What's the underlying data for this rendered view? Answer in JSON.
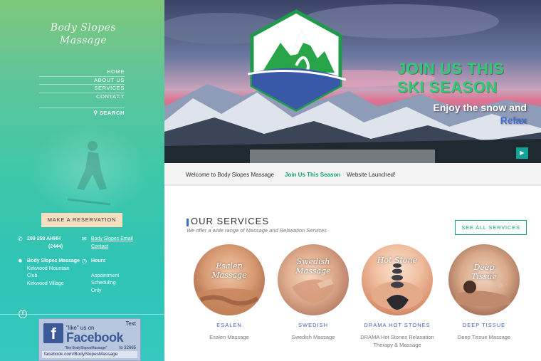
{
  "brand": {
    "logo_line1": "Body Slopes",
    "logo_line2": "Massage"
  },
  "nav": {
    "items": [
      "HOME",
      "ABOUT US",
      "SERVICES",
      "CONTACT"
    ],
    "search_label": "SEARCH",
    "search_icon": "search-icon"
  },
  "sidebar": {
    "reserve_label": "MAKE A RESERVATION",
    "phone": "209 258 AHHH",
    "phone_ext": "(2444)",
    "email_line1": "Body Slopes Email",
    "email_line2": "Contact",
    "address": [
      "Body Slopes Massage",
      "Kirkwood Mountain",
      "Club",
      "Kirkwood Village"
    ],
    "hours_title": "Hours",
    "hours_lines": [
      "Appointment",
      "Scheduling",
      "Only"
    ],
    "facebook_badge": {
      "text_tag": "Text",
      "like": "\"like\" us on",
      "brand": "Facebook",
      "tagline": "\"like BodySlopesMassage\"",
      "number": "to 32665",
      "url": "facebook.com/BodySlopesMassage"
    }
  },
  "hero": {
    "headline_line1": "JOIN US THIS",
    "headline_line2": "SKI SEASON",
    "sub_line1": "Enjoy the snow and",
    "sub_relax": "Relax",
    "play_icon": "play-icon"
  },
  "ticker": {
    "items": [
      "Welcome to Body Slopes Massage",
      "Join Us This Season",
      "Website Launched!"
    ],
    "active_index": 1
  },
  "services": {
    "title": "OUR SERVICES",
    "subtitle": "We offer a wide range of Massage and Relaxation Services",
    "see_all": "SEE ALL SERVICES",
    "cards": [
      {
        "image_label_1": "Esalen",
        "image_label_2": "Massage",
        "name": "ESALEN",
        "desc_1": "Esalen Massage",
        "desc_2": ""
      },
      {
        "image_label_1": "Swedish",
        "image_label_2": "Massage",
        "name": "SWEDISH",
        "desc_1": "Swedish Massage",
        "desc_2": ""
      },
      {
        "image_label_1": "Hot Stone",
        "image_label_2": "",
        "name": "DRAMA HOT STONES",
        "desc_1": "DRAMA Hot Stones Relaxation",
        "desc_2": "Therapy & Massage"
      },
      {
        "image_label_1": "Deep",
        "image_label_2": "Tissue",
        "name": "DEEP TISSUE",
        "desc_1": "Deep Tissue Massage",
        "desc_2": ""
      }
    ]
  },
  "colors": {
    "accent_green": "#13a574",
    "accent_blue": "#3b5fc0",
    "headline_green": "#2ecc71"
  }
}
